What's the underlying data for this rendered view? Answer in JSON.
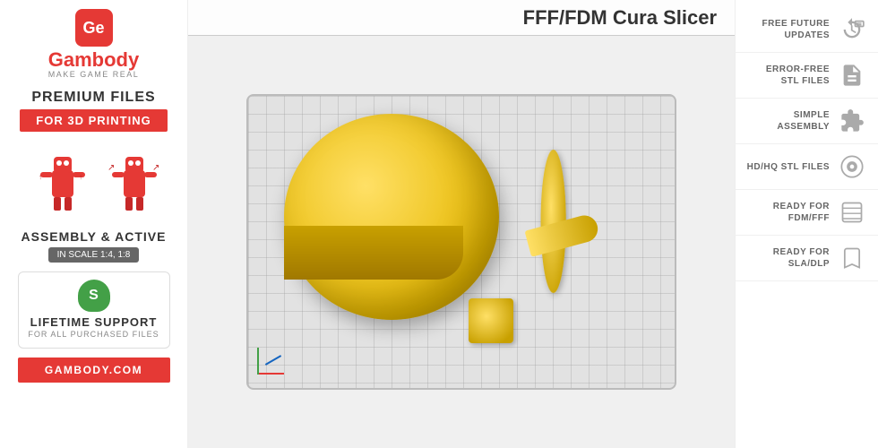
{
  "sidebar": {
    "logo_letters": "Ge",
    "brand_name": "Gambody",
    "brand_tagline": "MAKE GAME REAL",
    "premium_files": "PREMIUM FILES",
    "for_3d_printing": "FOR 3D PRINTING",
    "assembly_label": "ASSEMBLY & ACTIVE",
    "scale_badge": "IN SCALE 1:4, 1:8",
    "lifetime_support": "LIFETIME SUPPORT",
    "for_all_purchased": "FOR ALL PURCHASED FILES",
    "gambody_link": "GAMBODY.COM"
  },
  "title_bar": {
    "title": "FFF/FDM Cura Slicer"
  },
  "features": [
    {
      "label": "FREE FUTURE\nUPDATES",
      "icon": "updates-icon"
    },
    {
      "label": "ERROR-FREE\nSTL FILES",
      "icon": "stl-icon"
    },
    {
      "label": "SIMPLE\nASSEMBLY",
      "icon": "assembly-icon"
    },
    {
      "label": "HD/HQ\nSTL FILES",
      "icon": "hd-icon"
    },
    {
      "label": "READY FOR\nFDM/FFF",
      "icon": "fdm-icon"
    },
    {
      "label": "READY FOR\nSLA/DLP",
      "icon": "sla-icon"
    }
  ]
}
